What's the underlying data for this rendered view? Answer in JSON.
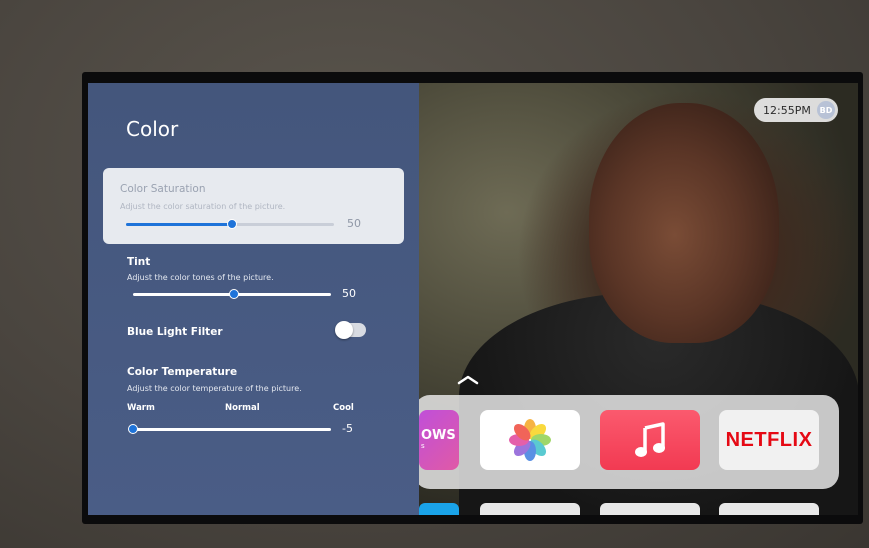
{
  "status": {
    "time": "12:55PM",
    "avatar_initials": "BD"
  },
  "panel": {
    "title": "Color",
    "items": [
      {
        "label": "Color Saturation",
        "description": "Adjust the color saturation of the picture.",
        "value": "50",
        "level": 0.5,
        "selected": true
      },
      {
        "label": "Tint",
        "description": "Adjust the color tones of the picture.",
        "value": "50",
        "level": 0.5
      },
      {
        "label": "Blue Light Filter",
        "toggle": "off"
      },
      {
        "label": "Color Temperature",
        "description": "Adjust the color temperature of the picture.",
        "value": "-5",
        "scale": {
          "left": "Warm",
          "middle": "Normal",
          "right": "Cool"
        }
      }
    ]
  },
  "dock": {
    "apps": [
      {
        "name": "partial-app",
        "label": "OWS",
        "sublabel": "s"
      },
      {
        "name": "photos",
        "icon": "photos-flower-icon"
      },
      {
        "name": "music",
        "icon": "music-note-icon"
      },
      {
        "name": "netflix",
        "label": "NETFLIX"
      }
    ]
  },
  "colors": {
    "panel": "#44567c",
    "accent": "#1e73d9",
    "netflix": "#e50914",
    "music": "#f23a52"
  }
}
